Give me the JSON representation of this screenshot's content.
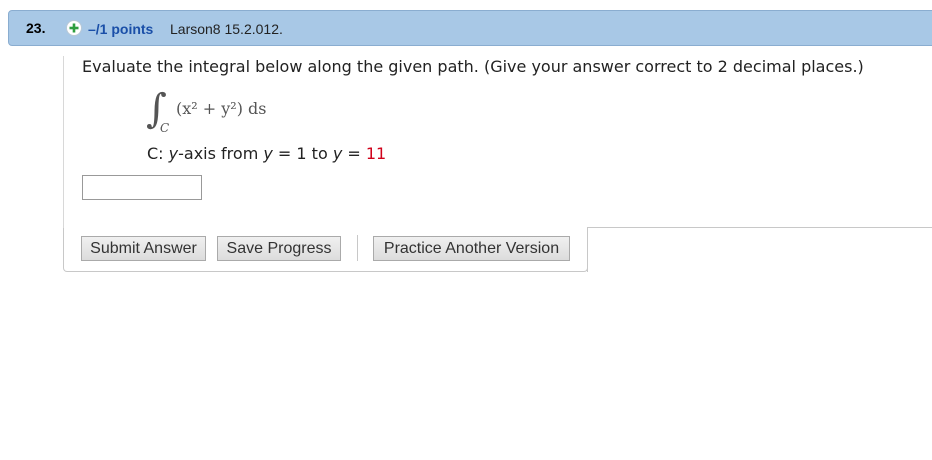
{
  "header": {
    "question_number": "23.",
    "points": "–/1 points",
    "source": "Larson8 15.2.012."
  },
  "question": {
    "prompt": "Evaluate the integral below along the given path. (Give your answer correct to 2 decimal places.)",
    "integrand": "(x² + y²) ds",
    "integral_subscript": "C",
    "path": {
      "prefix": "C: ",
      "variable_axis": "y",
      "axis_text": "-axis from ",
      "var1": "y",
      "eq1": " = 1 to ",
      "var2": "y",
      "eq2": " = ",
      "end_value": "11"
    },
    "answer_value": ""
  },
  "buttons": {
    "submit": "Submit Answer",
    "save": "Save Progress",
    "practice": "Practice Another Version"
  },
  "colors": {
    "header_bg": "#a8c8e6",
    "points_text": "#1a4fa8",
    "highlight_value": "#d0021b",
    "plus_icon": "#2e9e3f"
  },
  "icons": [
    "plus-icon"
  ]
}
